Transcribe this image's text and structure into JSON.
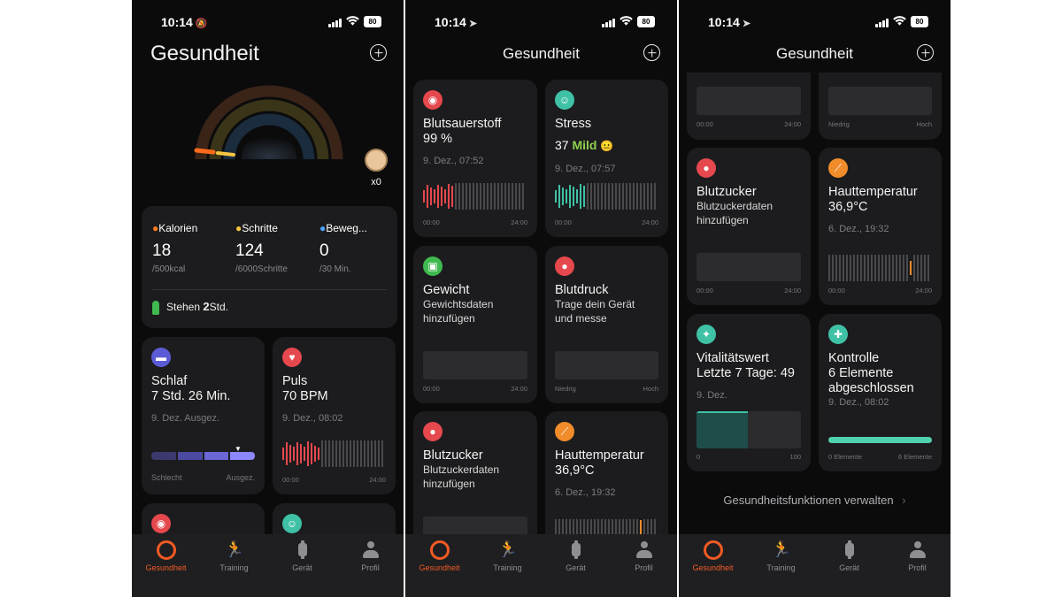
{
  "screens": [
    {
      "time": "10:14",
      "title": "Gesundheit",
      "battery": "80",
      "rewards": {
        "count": "x0"
      },
      "activity": {
        "items": [
          {
            "label": "Kalorien",
            "value": "18",
            "goal": "/500kcal",
            "icon": "flame-icon",
            "color": "#ff7a1a"
          },
          {
            "label": "Schritte",
            "value": "124",
            "goal": "/6000Schritte",
            "icon": "footprint-icon",
            "color": "#f5c542"
          },
          {
            "label": "Beweg...",
            "value": "0",
            "goal": "/30 Min.",
            "icon": "clock-icon",
            "color": "#4aa3ff"
          }
        ],
        "stand_label": "Stehen",
        "stand_value": "2",
        "stand_unit": "Std."
      },
      "cards": [
        {
          "title": "Schlaf",
          "value": "7 Std. 26 Min.",
          "date": "9. Dez. Ausgez.",
          "axis_left": "Schlecht",
          "axis_right": "Ausgez.",
          "icon": "bed-icon",
          "color": "#5b5bd6"
        },
        {
          "title": "Puls",
          "value": "70 BPM",
          "date": "9. Dez., 08:02",
          "axis_left": "00:00",
          "axis_right": "24:00",
          "icon": "heart-icon",
          "color": "#e5484d"
        }
      ]
    },
    {
      "time": "10:14",
      "title": "Gesundheit",
      "battery": "80",
      "cards": [
        {
          "title": "Blutsauerstoff",
          "value": "99 %",
          "date": "9. Dez., 07:52",
          "axis_left": "00:00",
          "axis_right": "24:00",
          "icon": "oxygen-icon",
          "color": "#e5484d"
        },
        {
          "title": "Stress",
          "value": "37",
          "status": "Mild",
          "emoji": "😐",
          "date": "9. Dez., 07:57",
          "axis_left": "00:00",
          "axis_right": "24:00",
          "icon": "face-icon",
          "color": "#3fc1a5"
        },
        {
          "title": "Gewicht",
          "line1": "Gewichtsdaten",
          "line2": "hinzufügen",
          "axis_left": "00:00",
          "axis_right": "24:00",
          "icon": "scale-icon",
          "color": "#3fb950"
        },
        {
          "title": "Blutdruck",
          "line1": "Trage dein Gerät",
          "line2": "und messe",
          "axis_left": "Niedrig",
          "axis_right": "Hoch",
          "icon": "drop-icon",
          "color": "#e5484d"
        },
        {
          "title": "Blutzucker",
          "line1": "Blutzuckerdaten",
          "line2": "hinzufügen",
          "icon": "drop-icon",
          "color": "#e5484d"
        },
        {
          "title": "Hauttemperatur",
          "value": "36,9°C",
          "date": "6. Dez., 19:32",
          "icon": "thermometer-icon",
          "color": "#f08c2a"
        }
      ]
    },
    {
      "time": "10:14",
      "title": "Gesundheit",
      "battery": "80",
      "top_axes": [
        {
          "left": "00:00",
          "right": "24:00"
        },
        {
          "left": "Niedrig",
          "right": "Hoch"
        }
      ],
      "cards": [
        {
          "title": "Blutzucker",
          "line1": "Blutzuckerdaten",
          "line2": "hinzufügen",
          "axis_left": "00:00",
          "axis_right": "24:00",
          "icon": "drop-icon",
          "color": "#e5484d"
        },
        {
          "title": "Hauttemperatur",
          "value": "36,9°C",
          "date": "6. Dez., 19:32",
          "axis_left": "00:00",
          "axis_right": "24:00",
          "icon": "thermometer-icon",
          "color": "#f08c2a"
        },
        {
          "title": "Vitalitätswert",
          "value": "Letzte 7 Tage: 49",
          "date": "9. Dez.",
          "axis_left": "0",
          "axis_right": "100",
          "icon": "vitality-icon",
          "color": "#3fc1a5"
        },
        {
          "title": "Kontrolle",
          "value": "6 Elemente",
          "value2": "abgeschlossen",
          "date": "9. Dez., 08:02",
          "axis_left": "0 Elemente",
          "axis_right": "6 Elemente",
          "icon": "person-check-icon",
          "color": "#3fc1a5"
        }
      ],
      "manage_link": "Gesundheitsfunktionen verwalten"
    }
  ],
  "tabs": [
    "Gesundheit",
    "Training",
    "Gerät",
    "Profil"
  ],
  "colors": {
    "accent": "#f15a24",
    "card": "#1c1c1e",
    "teal": "#3fc1a5",
    "red": "#e5484d"
  }
}
